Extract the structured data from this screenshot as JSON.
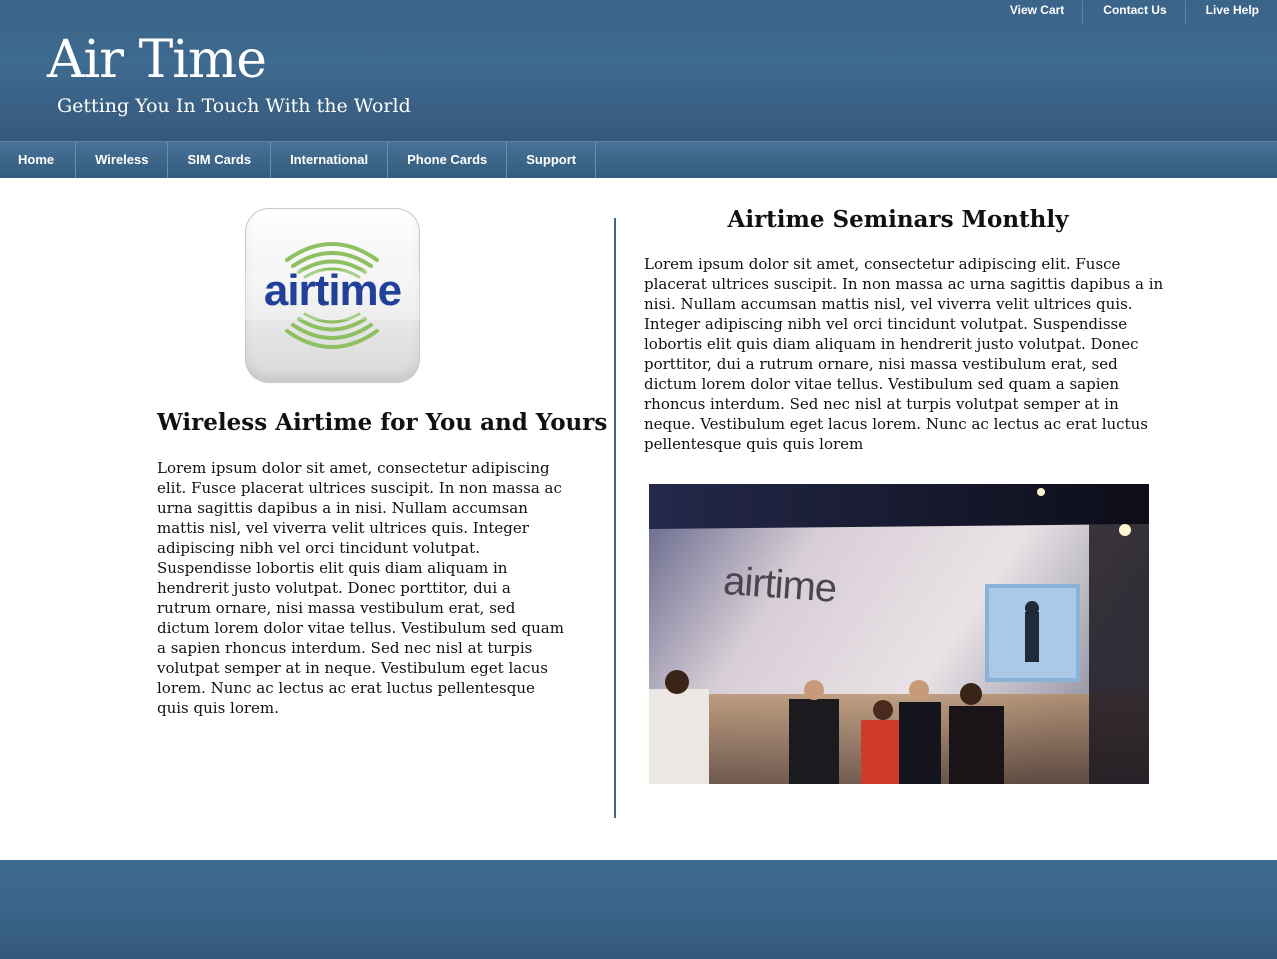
{
  "header": {
    "title": "Air Time",
    "tagline": "Getting You In Touch With the World",
    "top_links": [
      "View Cart",
      "Contact Us",
      "Live Help"
    ]
  },
  "nav": {
    "items": [
      "Home",
      "Wireless",
      "SIM Cards",
      "International",
      "Phone Cards",
      "Support"
    ]
  },
  "left": {
    "logo_text": "airtime",
    "heading": "Wireless Airtime for You and Yours",
    "body": "Lorem ipsum dolor sit amet, consectetur adipiscing elit. Fusce placerat ultrices suscipit. In non massa ac urna sagittis dapibus a in nisi. Nullam accumsan mattis nisl, vel viverra velit ultrices quis. Integer adipiscing nibh vel orci tincidunt volutpat. Suspendisse lobortis elit quis diam aliquam in hendrerit justo volutpat. Donec porttitor, dui a rutrum ornare, nisi massa vestibulum erat, sed dictum lorem dolor vitae tellus. Vestibulum sed quam a sapien rhoncus interdum. Sed nec nisl at turpis volutpat semper at in neque. Vestibulum eget lacus lorem. Nunc ac lectus ac erat luctus pellentesque quis quis lorem."
  },
  "right": {
    "heading": "Airtime Seminars Monthly",
    "body": "Lorem ipsum dolor sit amet, consectetur adipiscing elit. Fusce placerat ultrices suscipit. In non massa ac urna sagittis dapibus a in nisi. Nullam accumsan mattis nisl, vel viverra velit ultrices quis. Integer adipiscing nibh vel orci tincidunt volutpat. Suspendisse lobortis elit quis diam aliquam in hendrerit justo volutpat. Donec porttitor, dui a rutrum ornare, nisi massa vestibulum erat, sed dictum lorem dolor vitae tellus. Vestibulum sed quam a sapien rhoncus interdum. Sed nec nisl at turpis volutpat semper at in neque. Vestibulum eget lacus lorem. Nunc ac lectus ac erat luctus pellentesque quis quis lorem",
    "photo_wall_text": "airtime"
  },
  "colors": {
    "brand_blue": "#3a6488",
    "logo_blue": "#20409a",
    "logo_green": "#8cc060"
  }
}
